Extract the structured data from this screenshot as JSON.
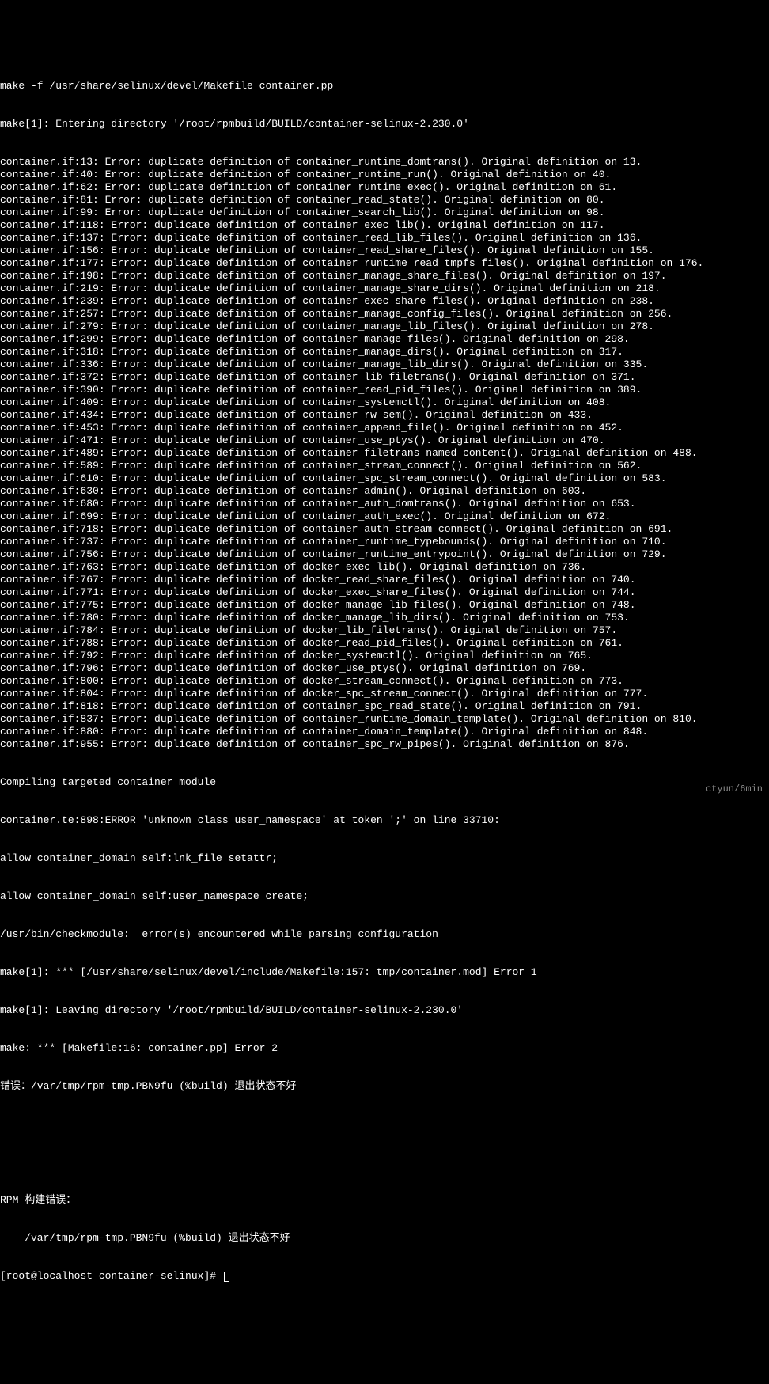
{
  "terminal": {
    "cmd": "make -f /usr/share/selinux/devel/Makefile container.pp",
    "enter_dir": "make[1]: Entering directory '/root/rpmbuild/BUILD/container-selinux-2.230.0'",
    "errors": [
      "container.if:13: Error: duplicate definition of container_runtime_domtrans(). Original definition on 13.",
      "container.if:40: Error: duplicate definition of container_runtime_run(). Original definition on 40.",
      "container.if:62: Error: duplicate definition of container_runtime_exec(). Original definition on 61.",
      "container.if:81: Error: duplicate definition of container_read_state(). Original definition on 80.",
      "container.if:99: Error: duplicate definition of container_search_lib(). Original definition on 98.",
      "container.if:118: Error: duplicate definition of container_exec_lib(). Original definition on 117.",
      "container.if:137: Error: duplicate definition of container_read_lib_files(). Original definition on 136.",
      "container.if:156: Error: duplicate definition of container_read_share_files(). Original definition on 155.",
      "container.if:177: Error: duplicate definition of container_runtime_read_tmpfs_files(). Original definition on 176.",
      "container.if:198: Error: duplicate definition of container_manage_share_files(). Original definition on 197.",
      "container.if:219: Error: duplicate definition of container_manage_share_dirs(). Original definition on 218.",
      "container.if:239: Error: duplicate definition of container_exec_share_files(). Original definition on 238.",
      "container.if:257: Error: duplicate definition of container_manage_config_files(). Original definition on 256.",
      "container.if:279: Error: duplicate definition of container_manage_lib_files(). Original definition on 278.",
      "container.if:299: Error: duplicate definition of container_manage_files(). Original definition on 298.",
      "container.if:318: Error: duplicate definition of container_manage_dirs(). Original definition on 317.",
      "container.if:336: Error: duplicate definition of container_manage_lib_dirs(). Original definition on 335.",
      "container.if:372: Error: duplicate definition of container_lib_filetrans(). Original definition on 371.",
      "container.if:390: Error: duplicate definition of container_read_pid_files(). Original definition on 389.",
      "container.if:409: Error: duplicate definition of container_systemctl(). Original definition on 408.",
      "container.if:434: Error: duplicate definition of container_rw_sem(). Original definition on 433.",
      "container.if:453: Error: duplicate definition of container_append_file(). Original definition on 452.",
      "container.if:471: Error: duplicate definition of container_use_ptys(). Original definition on 470.",
      "container.if:489: Error: duplicate definition of container_filetrans_named_content(). Original definition on 488.",
      "container.if:589: Error: duplicate definition of container_stream_connect(). Original definition on 562.",
      "container.if:610: Error: duplicate definition of container_spc_stream_connect(). Original definition on 583.",
      "container.if:630: Error: duplicate definition of container_admin(). Original definition on 603.",
      "container.if:680: Error: duplicate definition of container_auth_domtrans(). Original definition on 653.",
      "container.if:699: Error: duplicate definition of container_auth_exec(). Original definition on 672.",
      "container.if:718: Error: duplicate definition of container_auth_stream_connect(). Original definition on 691.",
      "container.if:737: Error: duplicate definition of container_runtime_typebounds(). Original definition on 710.",
      "container.if:756: Error: duplicate definition of container_runtime_entrypoint(). Original definition on 729.",
      "container.if:763: Error: duplicate definition of docker_exec_lib(). Original definition on 736.",
      "container.if:767: Error: duplicate definition of docker_read_share_files(). Original definition on 740.",
      "container.if:771: Error: duplicate definition of docker_exec_share_files(). Original definition on 744.",
      "container.if:775: Error: duplicate definition of docker_manage_lib_files(). Original definition on 748.",
      "container.if:780: Error: duplicate definition of docker_manage_lib_dirs(). Original definition on 753.",
      "container.if:784: Error: duplicate definition of docker_lib_filetrans(). Original definition on 757.",
      "container.if:788: Error: duplicate definition of docker_read_pid_files(). Original definition on 761.",
      "container.if:792: Error: duplicate definition of docker_systemctl(). Original definition on 765.",
      "container.if:796: Error: duplicate definition of docker_use_ptys(). Original definition on 769.",
      "container.if:800: Error: duplicate definition of docker_stream_connect(). Original definition on 773.",
      "container.if:804: Error: duplicate definition of docker_spc_stream_connect(). Original definition on 777.",
      "container.if:818: Error: duplicate definition of container_spc_read_state(). Original definition on 791.",
      "container.if:837: Error: duplicate definition of container_runtime_domain_template(). Original definition on 810.",
      "container.if:880: Error: duplicate definition of container_domain_template(). Original definition on 848.",
      "container.if:955: Error: duplicate definition of container_spc_rw_pipes(). Original definition on 876."
    ],
    "compiling": "Compiling targeted container module",
    "te_error": "container.te:898:ERROR 'unknown class user_namespace' at token ';' on line 33710:",
    "allow1": "allow container_domain self:lnk_file setattr;",
    "allow2": "allow container_domain self:user_namespace create;",
    "checkmodule": "/usr/bin/checkmodule:  error(s) encountered while parsing configuration",
    "make1_err": "make[1]: *** [/usr/share/selinux/devel/include/Makefile:157: tmp/container.mod] Error 1",
    "leave_dir": "make[1]: Leaving directory '/root/rpmbuild/BUILD/container-selinux-2.230.0'",
    "make_err": "make: *** [Makefile:16: container.pp] Error 2",
    "error_cn": "错误：/var/tmp/rpm-tmp.PBN9fu (%build) 退出状态不好",
    "rpm_build_err": "RPM 构建错误：",
    "rpm_build_detail": "    /var/tmp/rpm-tmp.PBN9fu (%build) 退出状态不好",
    "prompt": "[root@localhost container-selinux]# "
  },
  "watermark": "ctyun/6min"
}
